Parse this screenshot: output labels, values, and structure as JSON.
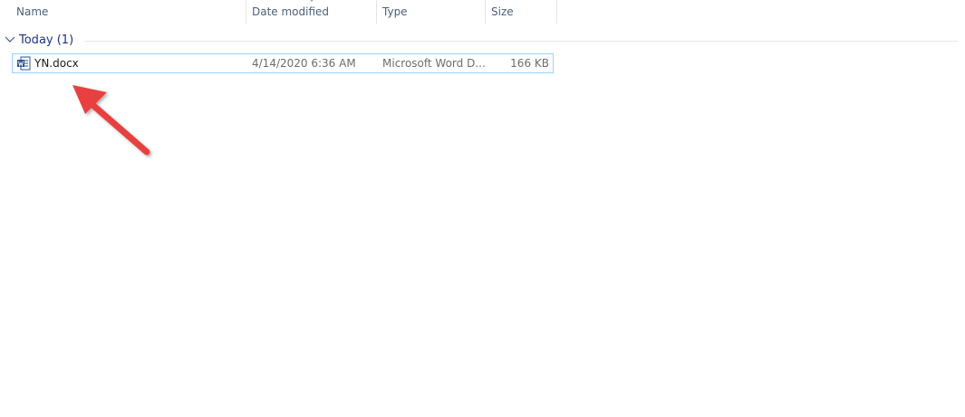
{
  "columns": {
    "name": "Name",
    "date_modified": "Date modified",
    "type": "Type",
    "size": "Size"
  },
  "group": {
    "label": "Today (1)",
    "expanded": true
  },
  "files": [
    {
      "name": "YN.docx",
      "date_modified": "4/14/2020 6:36 AM",
      "type": "Microsoft Word D...",
      "size": "166 KB",
      "icon": "word-document-icon",
      "selected_outline": true
    }
  ],
  "annotation": {
    "icon": "red-arrow-icon",
    "color": "#e8403f"
  },
  "colors": {
    "header_text": "#4c607a",
    "group_text": "#1e3287",
    "selection_border": "#99d1ff",
    "word_blue": "#2b5797"
  }
}
